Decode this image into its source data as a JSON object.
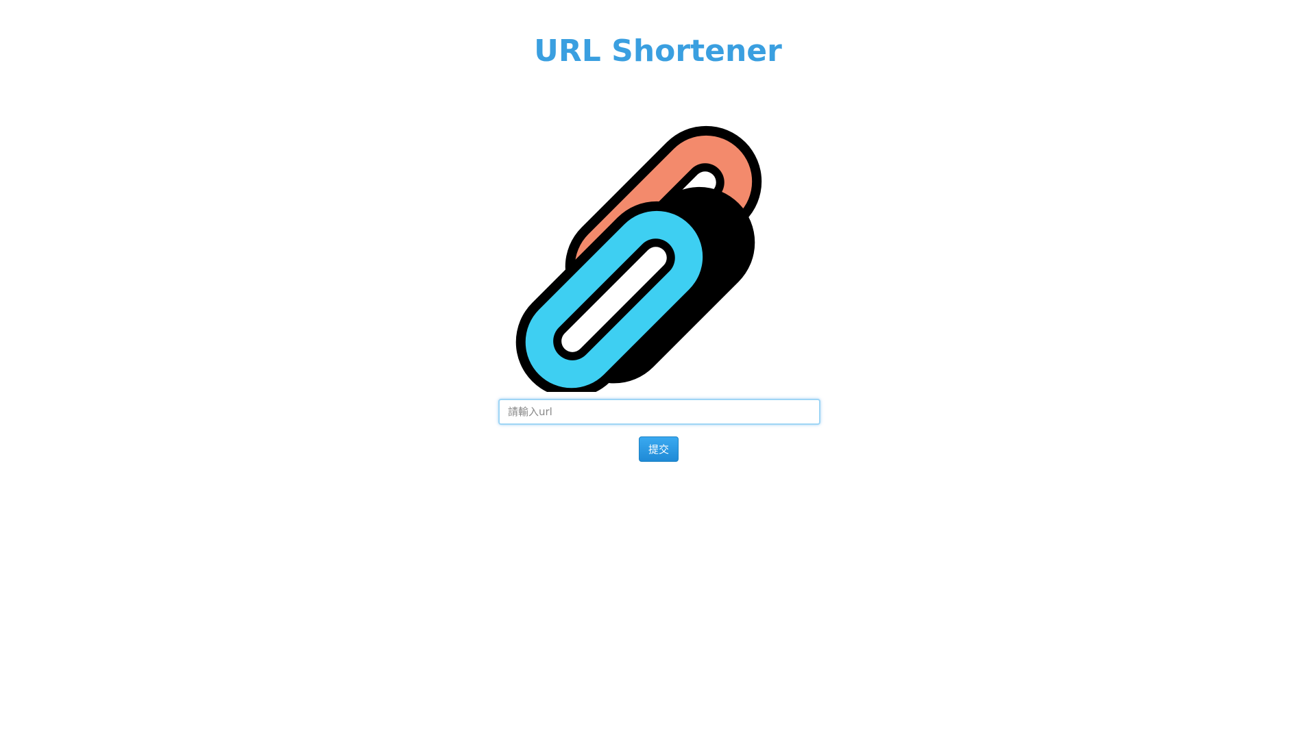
{
  "header": {
    "title": "URL Shortener"
  },
  "logo": {
    "icon": "chain-link-icon",
    "colors": {
      "front_link": "#3ecff2",
      "back_link": "#f38a6c",
      "outline": "#000000"
    }
  },
  "form": {
    "url_input": {
      "value": "",
      "placeholder": "請輸入url"
    },
    "submit_label": "提交"
  },
  "colors": {
    "title": "#3a9fe0",
    "button": "#2596e2",
    "input_focus_border": "#9ed5f5"
  }
}
